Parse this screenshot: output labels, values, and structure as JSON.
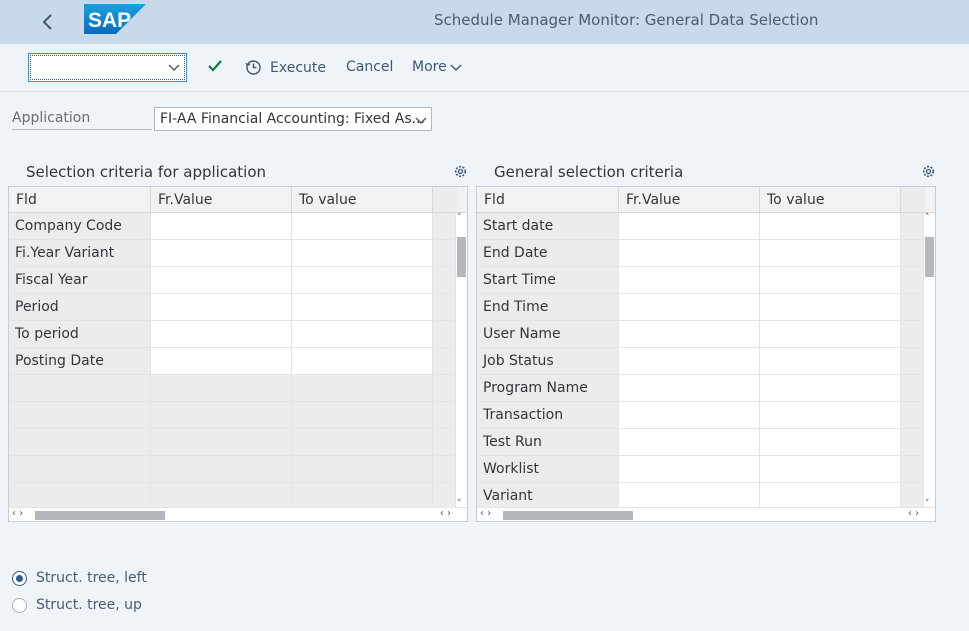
{
  "header": {
    "logo_text": "SAP",
    "title": "Schedule Manager Monitor: General Data Selection"
  },
  "toolbar": {
    "combo_value": "",
    "execute_label": "Execute",
    "cancel_label": "Cancel",
    "more_label": "More"
  },
  "application": {
    "label": "Application",
    "value": "FI-AA Financial Accounting: Fixed As..."
  },
  "left_panel": {
    "title": "Selection criteria for application",
    "columns": [
      "Fld",
      "Fr.Value",
      "To value"
    ],
    "rows": [
      "Company Code",
      "Fi.Year Variant",
      "Fiscal Year",
      "Period",
      "To period",
      "Posting Date"
    ]
  },
  "right_panel": {
    "title": "General selection criteria",
    "columns": [
      "Fld",
      "Fr.Value",
      "To value"
    ],
    "rows": [
      "Start date",
      "End Date",
      "Start Time",
      "End Time",
      "User Name",
      "Job Status",
      "Program Name",
      "Transaction",
      "Test Run",
      "Worklist",
      "Variant"
    ]
  },
  "display_options": {
    "option1": "Struct. tree, left",
    "option2": "Struct. tree, up",
    "selected": "option1"
  },
  "colors": {
    "header_bg": "#c8d9ea",
    "accent": "#3f5873",
    "check": "#107e3e"
  }
}
